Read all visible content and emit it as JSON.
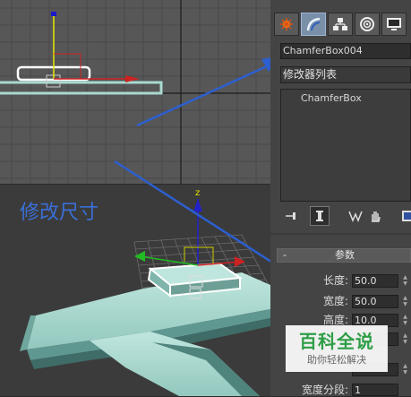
{
  "viewport_top": {
    "name": "top-viewport"
  },
  "viewport_persp": {
    "name": "perspective-viewport"
  },
  "annotation": {
    "text": "修改尺寸"
  },
  "gizmo": {
    "z_label": "z"
  },
  "command_panel": {
    "tabs": [
      {
        "icon": "create-icon"
      },
      {
        "icon": "modify-icon",
        "active": true
      },
      {
        "icon": "hierarchy-icon"
      },
      {
        "icon": "motion-icon"
      },
      {
        "icon": "display-icon"
      }
    ],
    "object_name": "ChamferBox004",
    "modifier_list": "修改器列表",
    "stack": [
      "ChamferBox"
    ],
    "stack_tools": [
      "pin-stack-icon",
      "show-end-result-icon",
      "make-unique-icon",
      "remove-modifier-icon",
      "configure-sets-icon"
    ]
  },
  "parameters": {
    "rollout_minus": "-",
    "rollout_title": "参数",
    "fields": [
      {
        "label": "长度:",
        "value": "50.0"
      },
      {
        "label": "宽度:",
        "value": "50.0"
      },
      {
        "label": "高度:",
        "value": "10.0"
      },
      {
        "label": "",
        "value": ""
      },
      {
        "label": "",
        "value": ""
      },
      {
        "label": "宽度分段:",
        "value": "1"
      }
    ]
  },
  "watermark": {
    "title": "百科全说",
    "subtitle": "助你轻松解决"
  },
  "colors": {
    "arrow_blue": "#2d5fd0",
    "selection_white": "#ffffff",
    "object_cyan": "#a9d9d0",
    "annotation_blue": "#3a6fd8",
    "axis_red": "#cc2222",
    "axis_green": "#22bb22",
    "axis_blue": "#2222cc",
    "axis_yellow": "#e8e800"
  }
}
